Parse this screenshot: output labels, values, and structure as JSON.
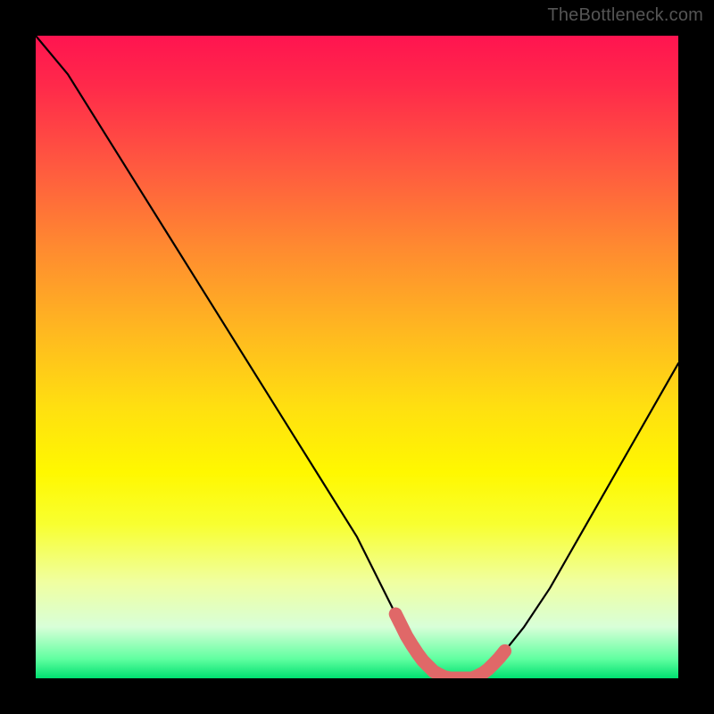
{
  "watermark": "TheBottleneck.com",
  "chart_data": {
    "type": "line",
    "title": "",
    "xlabel": "",
    "ylabel": "",
    "xlim": [
      0,
      100
    ],
    "ylim": [
      0,
      100
    ],
    "series": [
      {
        "name": "bottleneck-curve",
        "x": [
          0,
          5,
          10,
          15,
          20,
          25,
          30,
          35,
          40,
          45,
          50,
          54,
          56,
          58,
          60,
          62,
          64,
          66,
          68,
          70,
          72,
          76,
          80,
          84,
          88,
          92,
          96,
          100
        ],
        "values": [
          100,
          94,
          86,
          78,
          70,
          62,
          54,
          46,
          38,
          30,
          22,
          14,
          10,
          6,
          3,
          1,
          0,
          0,
          0,
          1,
          3,
          8,
          14,
          21,
          28,
          35,
          42,
          49
        ]
      }
    ],
    "highlight_segment": {
      "name": "optimal-range",
      "x_start": 56,
      "x_end": 73
    },
    "background_gradient": {
      "top": "#ff1450",
      "mid": "#fff800",
      "bottom": "#00e070"
    }
  }
}
